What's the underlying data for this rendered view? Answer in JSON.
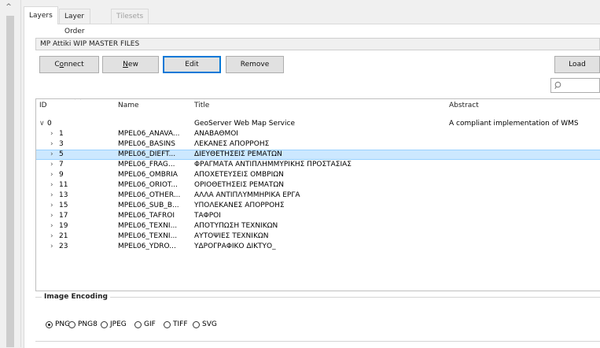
{
  "tabs": [
    {
      "label": "Layers",
      "state": "active"
    },
    {
      "label": "Layer Order",
      "state": "normal"
    },
    {
      "label": "Tilesets",
      "state": "disabled"
    }
  ],
  "connection_name": "MP Attiki WIP MASTER FILES",
  "buttons": {
    "connect": "Connect",
    "new": "New",
    "edit": "Edit",
    "remove": "Remove",
    "load": "Load"
  },
  "search": {
    "placeholder": ""
  },
  "table": {
    "headers": {
      "id": "ID",
      "name": "Name",
      "title": "Title",
      "abstract": "Abstract"
    },
    "rows": [
      {
        "id": "0",
        "name": "",
        "title": "GeoServer Web Map Service",
        "abstract": "A compliant implementation of WMS",
        "expanded": true,
        "level": 0
      },
      {
        "id": "1",
        "name": "MPEL06_ANAVA...",
        "title": "ΑΝΑΒΑΘΜΟΙ",
        "abstract": "",
        "level": 1
      },
      {
        "id": "3",
        "name": "MPEL06_BASINS",
        "title": "ΛΕΚΑΝΕΣ ΑΠΟΡΡΟΗΣ",
        "abstract": "",
        "level": 1
      },
      {
        "id": "5",
        "name": "MPEL06_DIEFT...",
        "title": "ΔΙΕΥΘΕΤΗΣΕΙΣ ΡΕΜΑΤΩΝ",
        "abstract": "",
        "level": 1,
        "selected": true
      },
      {
        "id": "7",
        "name": "MPEL06_FRAG...",
        "title": "ΦΡΑΓΜΑΤΑ ΑΝΤΙΠΛΗΜΜΥΡΙΚΗΣ ΠΡΟΣΤΑΣΙΑΣ",
        "abstract": "",
        "level": 1
      },
      {
        "id": "9",
        "name": "MPEL06_OMBRIA",
        "title": "ΑΠΟΧΕΤΕΥΣΕΙΣ ΟΜΒΡΙΩΝ",
        "abstract": "",
        "level": 1
      },
      {
        "id": "11",
        "name": "MPEL06_ORIOT...",
        "title": "ΟΡΙΟΘΕΤΗΣΕΙΣ ΡΕΜΑΤΩΝ",
        "abstract": "",
        "level": 1
      },
      {
        "id": "13",
        "name": "MPEL06_OTHER...",
        "title": "ΑΛΛΑ ΑΝΤΙΠΛΥΜΜΗΡΙΚΑ ΕΡΓΑ",
        "abstract": "",
        "level": 1
      },
      {
        "id": "15",
        "name": "MPEL06_SUB_B...",
        "title": "ΥΠΟΛΕΚΑΝΕΣ ΑΠΟΡΡΟΗΣ",
        "abstract": "",
        "level": 1
      },
      {
        "id": "17",
        "name": "MPEL06_TAFROI",
        "title": "ΤΑΦΡΟΙ",
        "abstract": "",
        "level": 1
      },
      {
        "id": "19",
        "name": "MPEL06_TEXNI...",
        "title": "ΑΠΟΤΥΠΩΣΗ ΤΕΧΝΙΚΩΝ",
        "abstract": "",
        "level": 1
      },
      {
        "id": "21",
        "name": "MPEL06_TEXNI...",
        "title": "ΑΥΤΟΨΙΕΣ ΤΕΧΝΙΚΩΝ",
        "abstract": "",
        "level": 1
      },
      {
        "id": "23",
        "name": "MPEL06_YDRO...",
        "title": "ΥΔΡΟΓΡΑΦΙΚΟ ΔΙΚΤΥΟ_",
        "abstract": "",
        "level": 1
      }
    ]
  },
  "image_encoding": {
    "title": "Image Encoding",
    "options": [
      {
        "label": "PNG",
        "selected": true
      },
      {
        "label": "PNG8",
        "selected": false
      },
      {
        "label": "JPEG",
        "selected": false
      },
      {
        "label": "GIF",
        "selected": false
      },
      {
        "label": "TIFF",
        "selected": false
      },
      {
        "label": "SVG",
        "selected": false
      }
    ]
  },
  "colors": {
    "selection": "#cce8ff",
    "focus_border": "#0078d7"
  }
}
